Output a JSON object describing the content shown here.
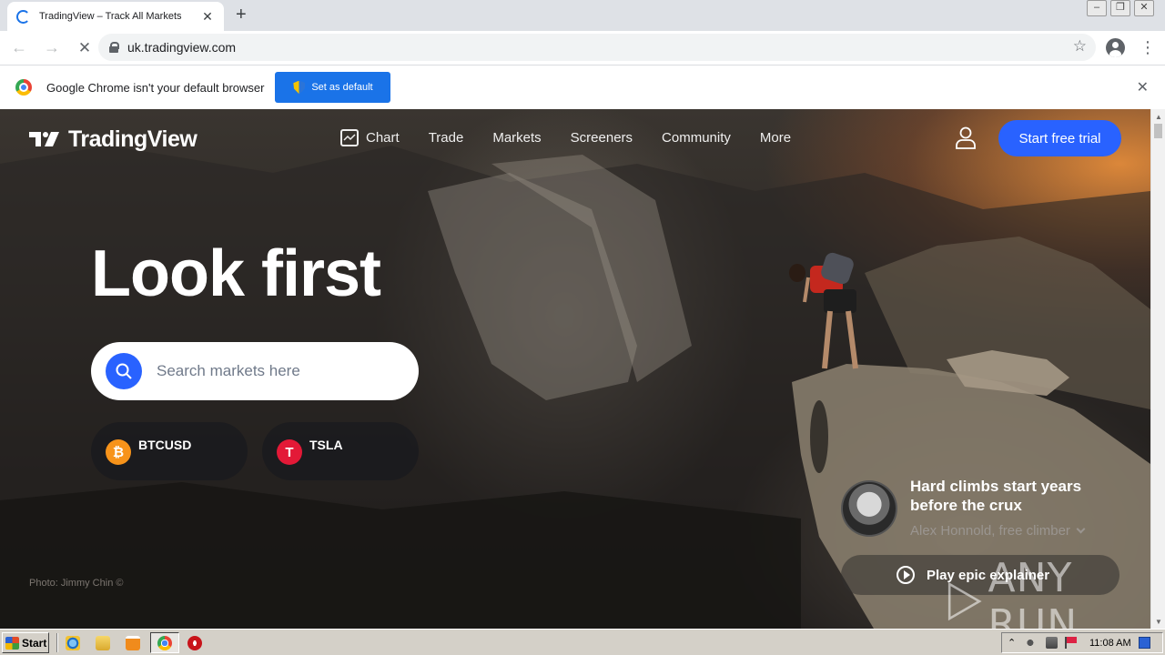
{
  "browser": {
    "tab_title": "TradingView – Track All Markets",
    "url": "uk.tradingview.com",
    "infobar_text": "Google Chrome isn't your default browser",
    "set_default_label": "Set as default"
  },
  "site": {
    "brand": "TradingView",
    "nav": [
      "Chart",
      "Trade",
      "Markets",
      "Screeners",
      "Community",
      "More"
    ],
    "cta": "Start free trial",
    "hero_title": "Look first",
    "search_placeholder": "Search markets here",
    "tickers": [
      {
        "symbol": "BTCUSD",
        "glyph": "₿",
        "color": "#f7931a"
      },
      {
        "symbol": "TSLA",
        "glyph": "T",
        "color": "#e31937"
      }
    ],
    "photo_credit": "Photo: Jimmy Chin ©",
    "quote": "Hard climbs start years before the crux",
    "quote_author": "Alex Honnold, free climber",
    "play_label": "Play epic explainer",
    "accent": "#2962ff"
  },
  "watermark": "ANY RUN",
  "taskbar": {
    "start_label": "Start",
    "clock": "11:08 AM"
  }
}
